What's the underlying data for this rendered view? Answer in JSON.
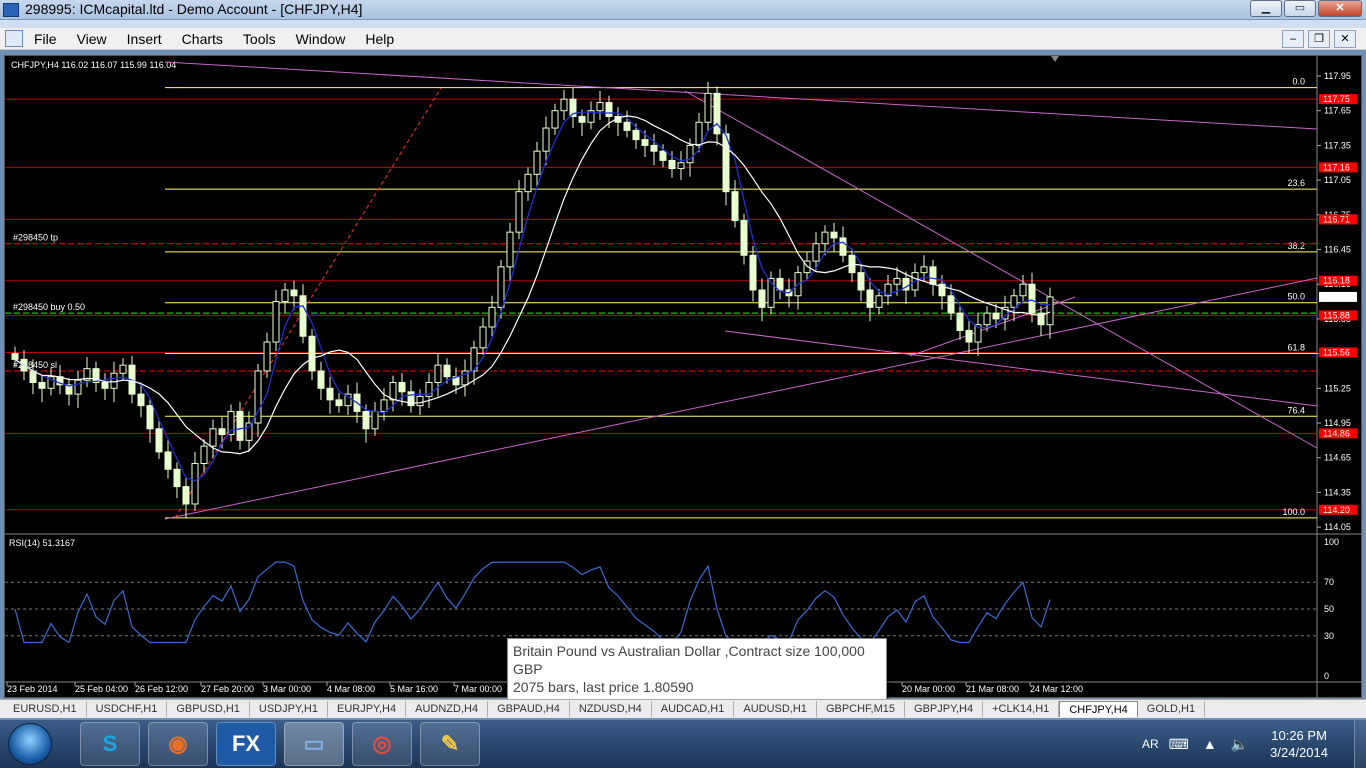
{
  "window": {
    "title": "298995: ICMcapital.ltd - Demo Account - [CHFJPY,H4]"
  },
  "menu": [
    "File",
    "View",
    "Insert",
    "Charts",
    "Tools",
    "Window",
    "Help"
  ],
  "chart": {
    "header": "CHFJPY,H4  116.02 116.07 115.99 116.04",
    "price_labels": [
      "117.95",
      "117.65",
      "117.35",
      "117.05",
      "116.75",
      "116.45",
      "116.15",
      "115.85",
      "115.55",
      "115.25",
      "114.95",
      "114.65",
      "114.35",
      "114.05"
    ],
    "highlighted_labels": [
      {
        "text": "117.75",
        "color": "#ff0000"
      },
      {
        "text": "117.16",
        "color": "#ff0000"
      },
      {
        "text": "116.71",
        "color": "#ff0000"
      },
      {
        "text": "116.18",
        "color": "#ff0000"
      },
      {
        "text": "116.04",
        "color": "#ffffff"
      },
      {
        "text": "115.88",
        "color": "#ff0000"
      },
      {
        "text": "115.56",
        "color": "#ff0000"
      },
      {
        "text": "114.86",
        "color": "#ff0000"
      },
      {
        "text": "114.20",
        "color": "#ff0000"
      }
    ],
    "fib_labels": [
      "0.0",
      "23.6",
      "38.2",
      "50.0",
      "61.8",
      "76.4",
      "100.0"
    ],
    "order_labels": [
      "#298450 tp",
      "#298450 buy 0.50",
      "#298450 sl"
    ],
    "rsi_header": "RSI(14) 51.3167",
    "rsi_levels": [
      "100",
      "70",
      "50",
      "30",
      "0"
    ],
    "time_labels": [
      "23 Feb 2014",
      "25 Feb 04:00",
      "26 Feb 12:00",
      "27 Feb 20:00",
      "3 Mar 00:00",
      "4 Mar 08:00",
      "5 Mar 16:00",
      "7 Mar 00:00",
      "20 Mar 00:00",
      "21 Mar 08:00",
      "24 Mar 12:00"
    ]
  },
  "tooltip": {
    "line1": "Britain Pound vs Australian Dollar ,Contract size 100,000",
    "line2": "GBP",
    "line3": "2075 bars, last price 1.80590"
  },
  "tabs": [
    "EURUSD,H1",
    "USDCHF,H1",
    "GBPUSD,H1",
    "USDJPY,H1",
    "EURJPY,H4",
    "AUDNZD,H4",
    "GBPAUD,H4",
    "NZDUSD,H4",
    "AUDCAD,H1",
    "AUDUSD,H1",
    "GBPCHF,M15",
    "GBPJPY,H4",
    "+CLK14,H1",
    "CHFJPY,H4",
    "GOLD,H1"
  ],
  "active_tab": "CHFJPY,H4",
  "taskbar": {
    "fx_label": "FX",
    "lang": "AR",
    "time": "10:26 PM",
    "date": "3/24/2014"
  },
  "colors": {
    "candle": "#e6ffcc",
    "fib": "#ffff66",
    "level": "#ff0000",
    "trend": "#cc66cc",
    "ma_fast": "#1f2fd8",
    "ma_slow": "#ffffff",
    "rsi": "#3a6bd8"
  }
}
